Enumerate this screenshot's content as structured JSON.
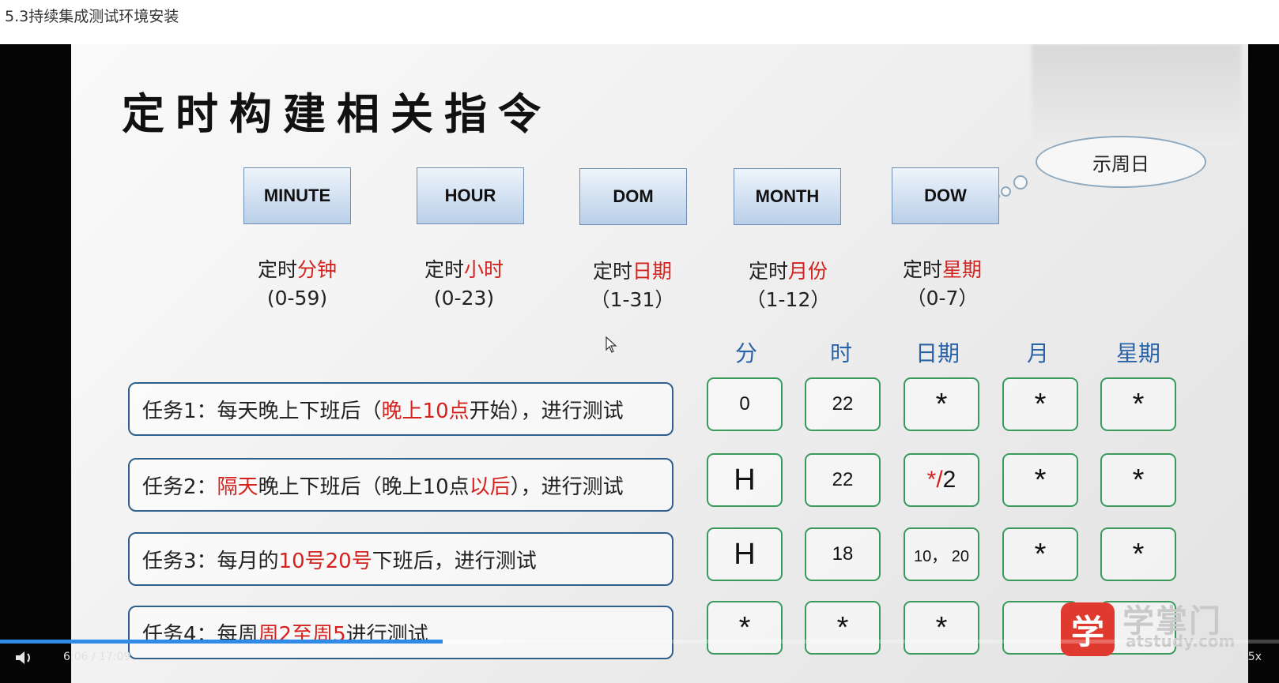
{
  "page_title": "5.3持续集成测试环境安装",
  "slide": {
    "title": "定时构建相关指令",
    "bubble_text": "示周日",
    "fields": [
      {
        "name": "MINUTE",
        "desc_prefix": "定时",
        "desc_red": "分钟",
        "range": "(0-59)"
      },
      {
        "name": "HOUR",
        "desc_prefix": "定时",
        "desc_red": "小时",
        "range": "(0-23)"
      },
      {
        "name": "DOM",
        "desc_prefix": "定时",
        "desc_red": "日期",
        "range": "（1-31）"
      },
      {
        "name": "MONTH",
        "desc_prefix": "定时",
        "desc_red": "月份",
        "range": "（1-12）"
      },
      {
        "name": "DOW",
        "desc_prefix": "定时",
        "desc_red": "星期",
        "range": "（0-7）"
      }
    ],
    "column_headers": [
      "分",
      "时",
      "日期",
      "月",
      "星期"
    ],
    "tasks": [
      {
        "segments": [
          {
            "text": "任务1：每天晚上下班后（"
          },
          {
            "text": "晚上10点",
            "red": true
          },
          {
            "text": "开始），进行测试"
          }
        ],
        "values": [
          "0",
          "22",
          "*",
          "*",
          "*"
        ]
      },
      {
        "segments": [
          {
            "text": "任务2："
          },
          {
            "text": "隔天",
            "red": true
          },
          {
            "text": "晚上下班后（晚上10点"
          },
          {
            "text": "以后",
            "red": true
          },
          {
            "text": "），进行测试"
          }
        ],
        "values": [
          "H",
          "22",
          "*/2",
          "*",
          "*"
        ]
      },
      {
        "segments": [
          {
            "text": "任务3：每月的"
          },
          {
            "text": "10号20号",
            "red": true
          },
          {
            "text": "下班后，进行测试"
          }
        ],
        "values": [
          "H",
          "18",
          "10，  20",
          "*",
          "*"
        ]
      },
      {
        "segments": [
          {
            "text": "任务4：每周"
          },
          {
            "text": "周2至周5",
            "red": true
          },
          {
            "text": "进行测试"
          }
        ],
        "values": [
          "*",
          "*",
          "*",
          "",
          ""
        ]
      }
    ],
    "logo": {
      "badge": "学",
      "name": "学掌门",
      "url": "atstudy.com"
    }
  },
  "player": {
    "time": "6:06 / 17:09",
    "speed": "1.5x",
    "played_fraction": 0.346,
    "buffered_fraction": 0.392
  },
  "colors": {
    "accent_red": "#d4231f",
    "header_blue": "#2b63a8",
    "cell_green": "#3a9a5c",
    "progress_blue": "#2f8be6"
  }
}
